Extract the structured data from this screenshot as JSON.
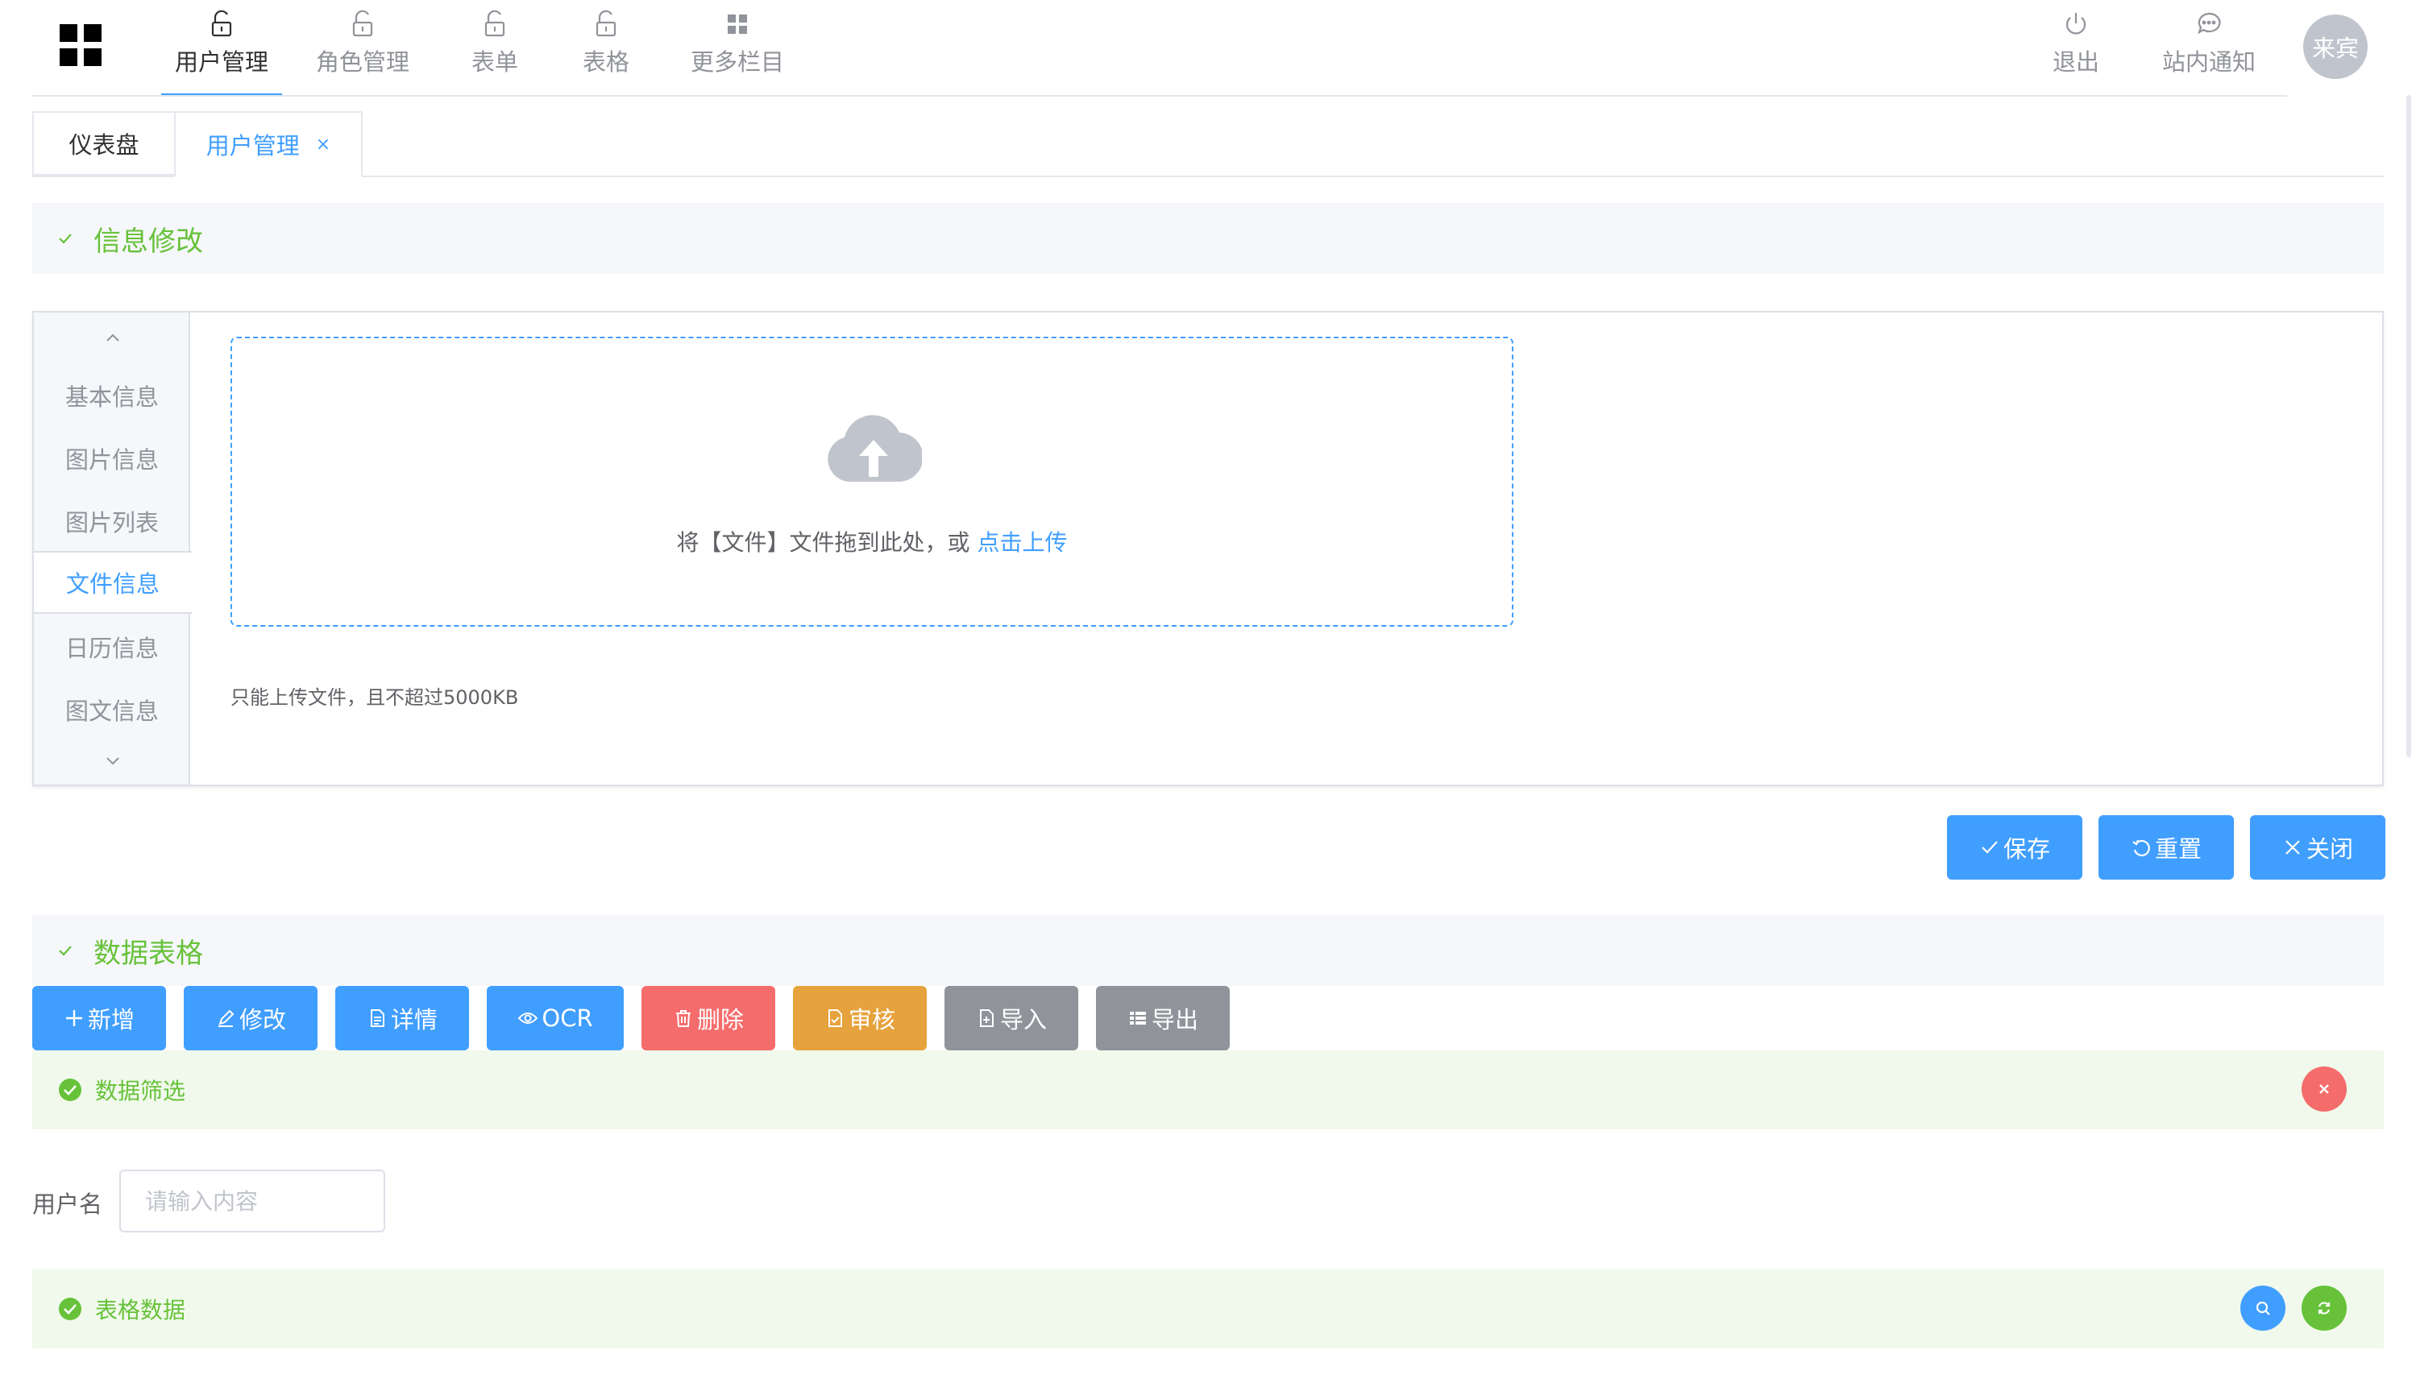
{
  "header": {
    "nav_items": [
      {
        "label": "用户管理",
        "icon": "unlock-icon",
        "active": true
      },
      {
        "label": "角色管理",
        "icon": "unlock-icon",
        "active": false
      },
      {
        "label": "表单",
        "icon": "unlock-icon",
        "active": false
      },
      {
        "label": "表格",
        "icon": "unlock-icon",
        "active": false
      },
      {
        "label": "更多栏目",
        "icon": "grid-icon",
        "active": false
      }
    ],
    "right_items": [
      {
        "label": "退出",
        "icon": "power-icon"
      },
      {
        "label": "站内通知",
        "icon": "chat-bubble-icon"
      }
    ],
    "avatar_text": "来宾"
  },
  "page_tabs": [
    {
      "label": "仪表盘",
      "active": false,
      "closable": false
    },
    {
      "label": "用户管理",
      "active": true,
      "closable": true,
      "close_glyph": "×"
    }
  ],
  "info_section": {
    "title": "信息修改",
    "side_tabs": [
      "基本信息",
      "图片信息",
      "图片列表",
      "文件信息",
      "日历信息",
      "图文信息"
    ],
    "active_side_tab": "文件信息",
    "upload": {
      "text": "将【文件】文件拖到此处，或",
      "link": "点击上传",
      "tip": "只能上传文件，且不超过5000KB"
    },
    "actions": {
      "save": "保存",
      "reset": "重置",
      "close": "关闭"
    }
  },
  "data_section": {
    "title": "数据表格",
    "toolbar": {
      "add": "新增",
      "edit": "修改",
      "detail": "详情",
      "ocr": "OCR",
      "delete": "删除",
      "audit": "审核",
      "import": "导入",
      "export": "导出"
    },
    "filter_alert_title": "数据筛选",
    "filter": {
      "label": "用户名",
      "placeholder": "请输入内容"
    },
    "table_alert_title": "表格数据"
  },
  "colors": {
    "primary": "#409eff",
    "success": "#67c23a",
    "danger": "#f56c6c",
    "warning": "#e6a23c",
    "info": "#909399"
  }
}
